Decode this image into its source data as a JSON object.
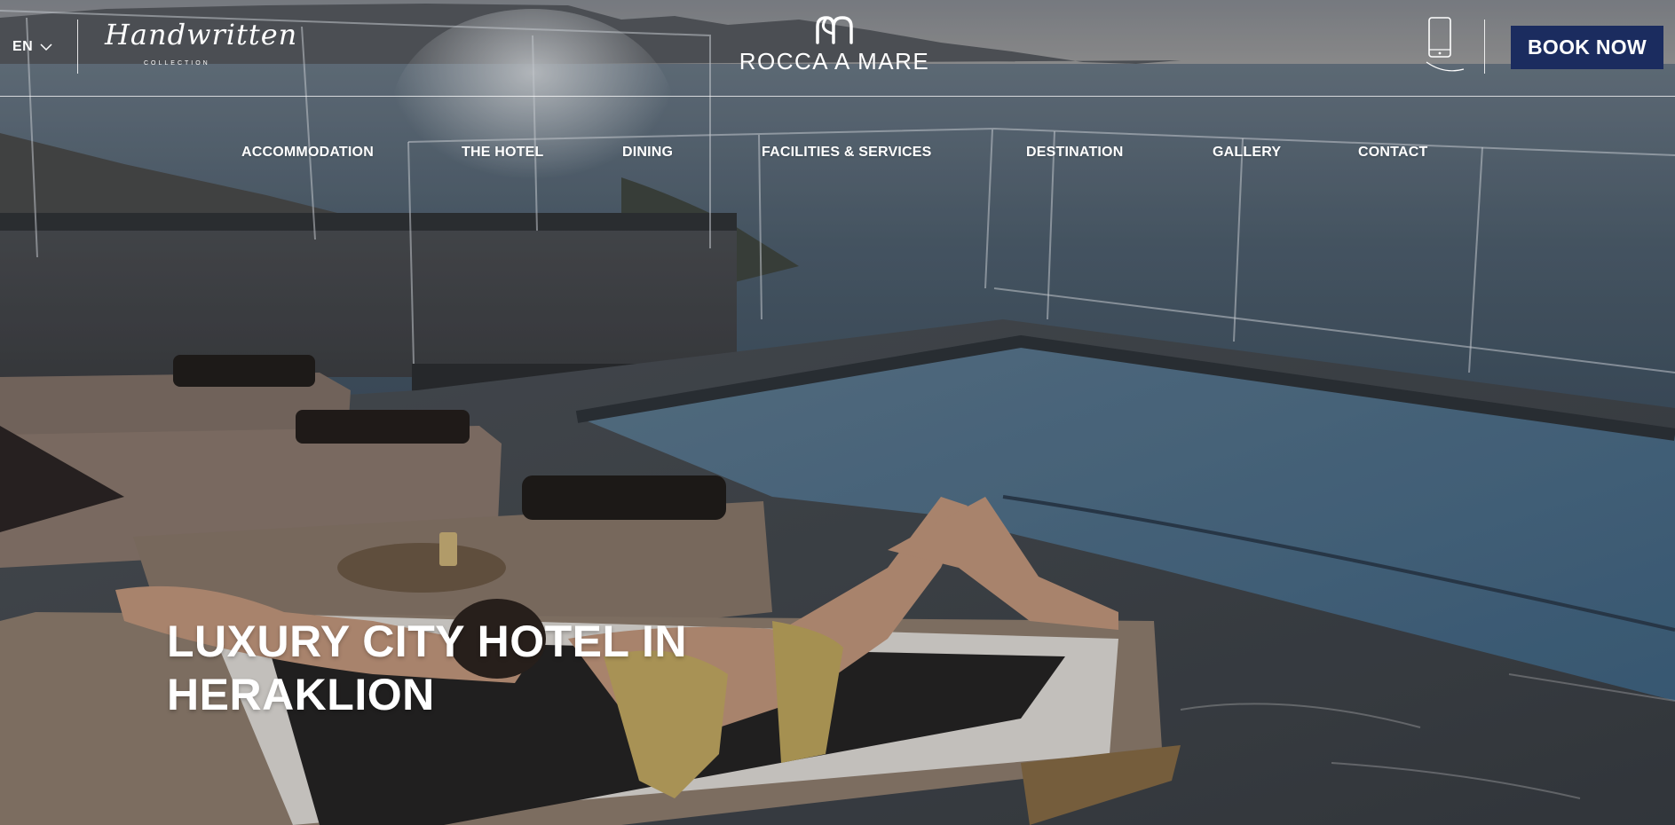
{
  "header": {
    "language": "EN",
    "sub_brand": {
      "script": "Handwritten",
      "tagline": "COLLECTION"
    },
    "brand": {
      "name": "ROCCA A MARE",
      "mark_icon": "rm-monogram-icon"
    },
    "phone_icon": "mobile-phone-icon",
    "book_label": "BOOK NOW",
    "book_color": "#1b2c5f"
  },
  "nav": {
    "items": [
      {
        "label": "ACCOMMODATION"
      },
      {
        "label": "THE HOTEL"
      },
      {
        "label": "DINING"
      },
      {
        "label": "FACILITIES & SERVICES"
      },
      {
        "label": "DESTINATION"
      },
      {
        "label": "GALLERY"
      },
      {
        "label": "CONTACT"
      }
    ]
  },
  "hero": {
    "headline_line1": "LUXURY CITY HOTEL IN",
    "headline_line2": "HERAKLION"
  }
}
